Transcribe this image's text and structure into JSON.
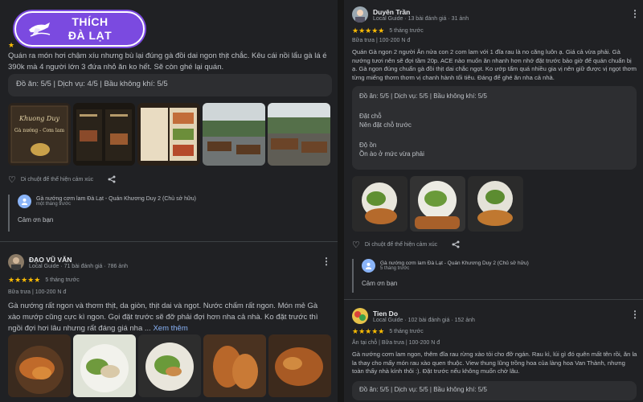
{
  "logo": {
    "line1": "THÍCH",
    "line2": "ĐÀ LẠT"
  },
  "left": {
    "review1": {
      "text": "Quán ra món hơi chậm xíu nhưng bù lại đúng gà đồi dai ngon thịt chắc. Kêu cái nồi lẩu gà lá é 390k mà 4 người lớn 3 đứa nhỏ ăn ko hết. Sẽ còn ghé lại quán.",
      "ratings": "Đồ ăn: 5/5  |  Dịch vụ: 4/5  |  Bầu không khí: 5/5",
      "like_hint": "Di chuột để thể hiện cảm xúc",
      "reply": {
        "owner": "Gà nướng cơm lam Đà Lạt - Quán Khương Duy 2 (Chủ sở hữu)",
        "time": "một tháng trước",
        "text": "Cảm ơn bạn"
      }
    },
    "review2": {
      "name": "ĐẠO VŨ VĂN",
      "meta": "Local Guide · 71 bài đánh giá · 786 ảnh",
      "stars": "★★★★★",
      "time": "5 tháng trước",
      "meal": "Bữa trưa  |  100-200 N đ",
      "text": "Gà nướng rất ngon và thơm thịt, da giòn, thịt dai và ngọt. Nước chấm rất ngon. Món mẻ Gà xào mướp cũng cực kì ngon. Gọi đặt trước sẽ đỡ phải đợi hơn nha cả nhà. Ko đặt trước thì ngồi đợi hơi lâu nhưng rất đáng giá nha ...",
      "more": "Xem thêm"
    }
  },
  "right": {
    "review1": {
      "name": "Duyên Trần",
      "meta": "Local Guide · 13 bài đánh giá · 31 ảnh",
      "stars": "★★★★★",
      "time": "5 tháng trước",
      "meal": "Bữa trưa  |  100-200 N đ",
      "text": "Quán Gà ngon 2 người Ăn nửa con 2 com lam với 1 đĩa rau là no căng luôn ạ. Giá cả vừa phải. Gà nướng tươi nên sẽ đợi tầm 20p. ACE nào muốn ăn nhanh hơn nhớ đặt trước bảo giờ để quán chuẩn bị ạ. Gà ngon đúng chuẩn gà đồi thịt dai chắc ngọt. Ko ướp tẩm quá nhiều gia vị nên giữ được vị ngọt thơm từng miếng thơm thơm vị chanh hành tối tiêu. Đáng để ghé ăn nha cả nhà.",
      "ratings": "Đồ ăn: 5/5  |  Dịch vụ: 5/5  |  Bầu không khí: 5/5",
      "booking_label": "Đặt chỗ",
      "booking_value": "Nên đặt chỗ trước",
      "noise_label": "Độ ồn",
      "noise_value": "Ồn ào ở mức vừa phải",
      "like_hint": "Di chuột để thể hiện cảm xúc",
      "reply": {
        "owner": "Gà nướng cơm lam Đà Lạt - Quán Khương Duy 2 (Chủ sở hữu)",
        "time": "5 tháng trước",
        "text": "Cảm ơn bạn"
      }
    },
    "review2": {
      "name": "Tien Do",
      "meta": "Local Guide · 102 bài đánh giá · 152 ảnh",
      "stars": "★★★★★",
      "time": "5 tháng trước",
      "meal": "Ăn tại chỗ  |  Bữa trưa  |  100-200 N đ",
      "text": "Gà nướng cơm lam ngon, thêm đĩa rau rừng xào tỏi cho đỡ ngán. Rau kì, lúi gì đó quên mất tên rồi, ăn la la thay cho mấy món rau xào quen thuộc. View thung lũng trồng hoa của làng hoa Van Thành, nhưng toàn thấy nhà kính thôi :). Đặt trước nếu không muốn chờ lâu.",
      "ratings": "Đồ ăn: 5/5  |  Dịch vụ: 5/5  |  Bầu không khí: 5/5"
    }
  }
}
